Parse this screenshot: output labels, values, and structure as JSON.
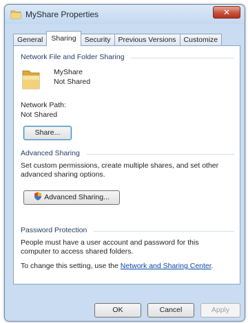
{
  "window": {
    "title": "MyShare Properties",
    "close_label": "✕"
  },
  "tabs": [
    {
      "label": "General"
    },
    {
      "label": "Sharing"
    },
    {
      "label": "Security"
    },
    {
      "label": "Previous Versions"
    },
    {
      "label": "Customize"
    }
  ],
  "network_sharing": {
    "title": "Network File and Folder Sharing",
    "folder_name": "MyShare",
    "status": "Not Shared",
    "path_label": "Network Path:",
    "path_value": "Not Shared",
    "share_button": "Share..."
  },
  "advanced_sharing": {
    "title": "Advanced Sharing",
    "description": "Set custom permissions, create multiple shares, and set other advanced sharing options.",
    "button": "Advanced Sharing..."
  },
  "password_protection": {
    "title": "Password Protection",
    "description": "People must have a user account and password for this computer to access shared folders.",
    "change_prefix": "To change this setting, use the ",
    "link": "Network and Sharing Center",
    "change_suffix": "."
  },
  "footer": {
    "ok": "OK",
    "cancel": "Cancel",
    "apply": "Apply"
  },
  "colors": {
    "frame": "#c9dcf1",
    "link": "#0645ad",
    "close": "#c8513a"
  }
}
